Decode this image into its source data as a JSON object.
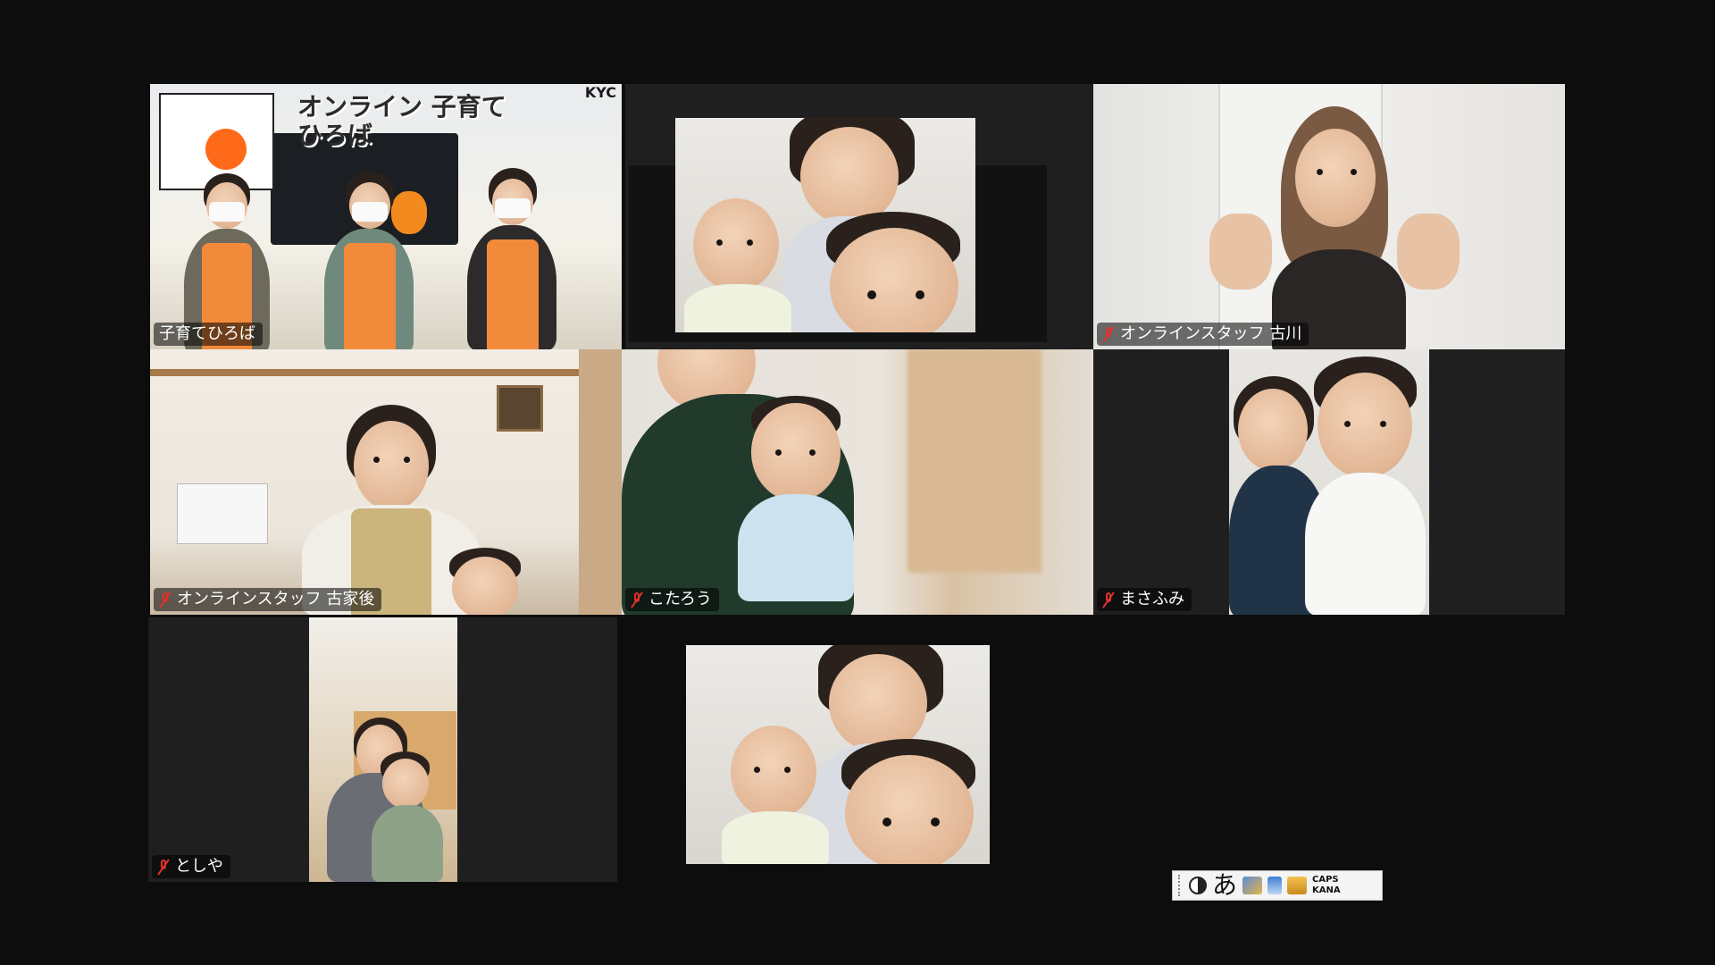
{
  "meeting": {
    "participants": [
      {
        "name": "子育てひろば",
        "muted": false,
        "active_speaker": true
      },
      {
        "name": "",
        "muted": false,
        "active_speaker": false
      },
      {
        "name": "オンラインスタッフ 古川",
        "muted": true,
        "active_speaker": false
      },
      {
        "name": "オンラインスタッフ 古家後",
        "muted": true,
        "active_speaker": false
      },
      {
        "name": "こたろう",
        "muted": true,
        "active_speaker": false
      },
      {
        "name": "まさふみ",
        "muted": true,
        "active_speaker": false
      },
      {
        "name": "としや",
        "muted": true,
        "active_speaker": false
      }
    ],
    "banner_text": "オンライン 子育てひろば",
    "corner_logo": "KYC",
    "active_color": "#3cd46a",
    "muted_color": "#e0322b"
  },
  "ime_toolbar": {
    "mode_label": "あ",
    "caps_label": "CAPS",
    "kana_label": "KANA"
  }
}
